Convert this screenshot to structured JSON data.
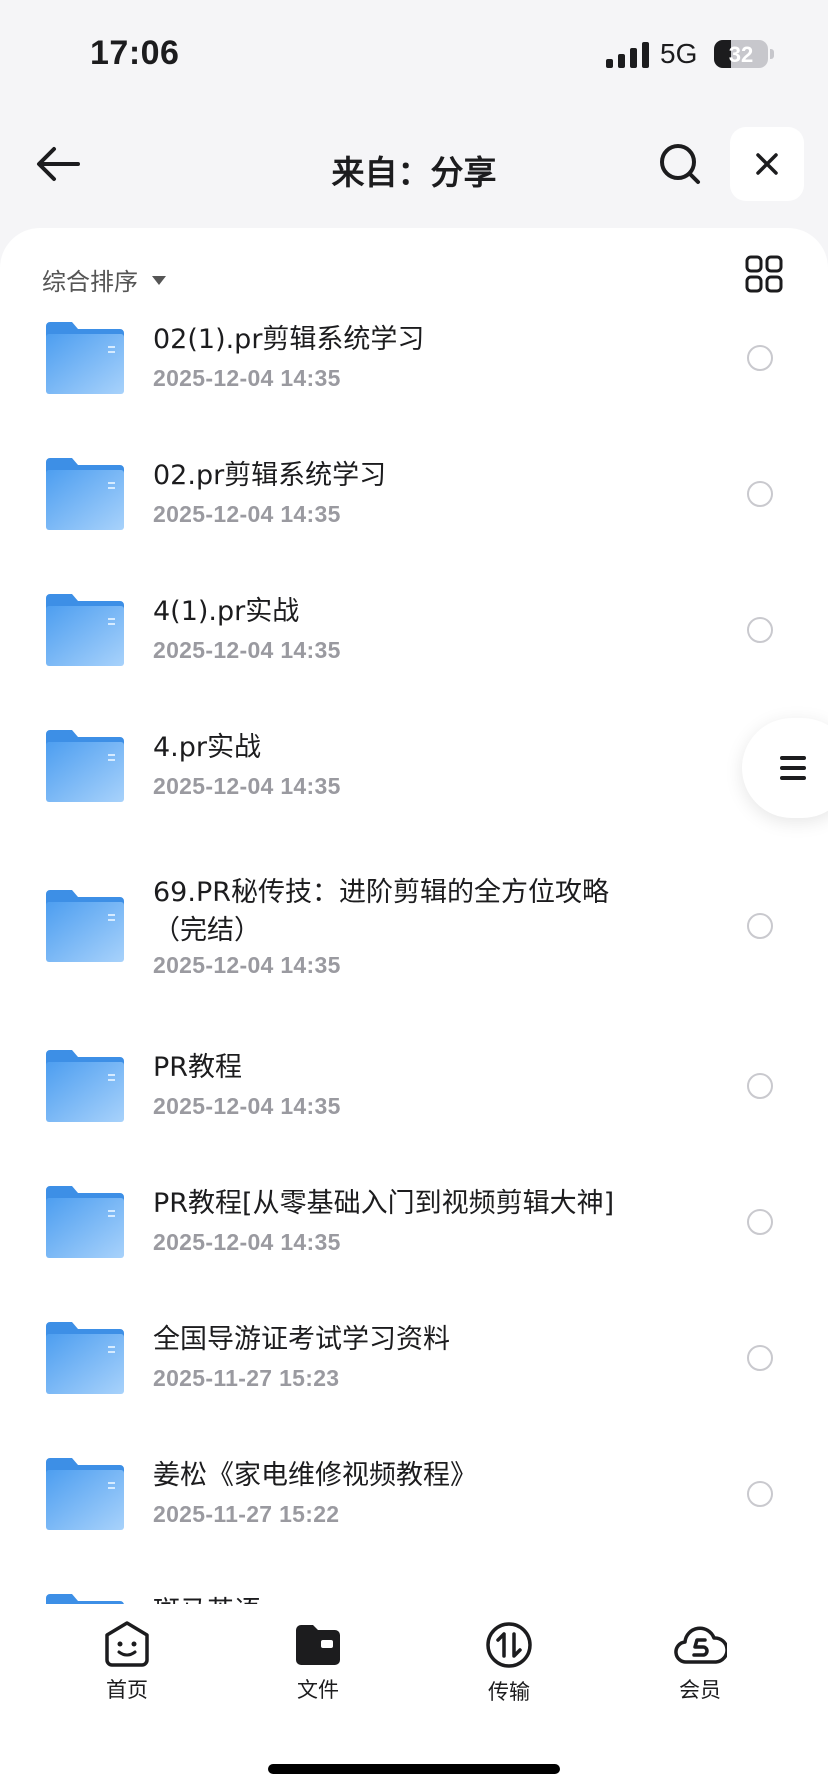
{
  "status_bar": {
    "time": "17:06",
    "network": "5G",
    "battery_percent": "32",
    "battery_level": 0.32
  },
  "header": {
    "title": "来自：分享",
    "back_icon": "arrow-left-icon",
    "search_icon": "search-icon",
    "close_icon": "close-icon"
  },
  "toolbar": {
    "sort_label": "综合排序",
    "view_toggle_icon": "grid-view-icon"
  },
  "files": [
    {
      "name": "02(1).pr剪辑系统学习",
      "date": "2025-12-04 14:35"
    },
    {
      "name": "02.pr剪辑系统学习",
      "date": "2025-12-04 14:35"
    },
    {
      "name": "4(1).pr实战",
      "date": "2025-12-04 14:35"
    },
    {
      "name": "4.pr实战",
      "date": "2025-12-04 14:35"
    },
    {
      "name": "69.PR秘传技：进阶剪辑的全方位攻略（完结）",
      "date": "2025-12-04 14:35"
    },
    {
      "name": "PR教程",
      "date": "2025-12-04 14:35"
    },
    {
      "name": "PR教程[从零基础入门到视频剪辑大神]",
      "date": "2025-12-04 14:35"
    },
    {
      "name": "全国导游证考试学习资料",
      "date": "2025-11-27 15:23"
    },
    {
      "name": "姜松《家电维修视频教程》",
      "date": "2025-11-27 15:22"
    },
    {
      "name": "斑马英语",
      "date": ""
    }
  ],
  "bottom_nav": {
    "items": [
      {
        "label": "首页",
        "icon": "smiley-home-icon"
      },
      {
        "label": "文件",
        "icon": "folder-icon"
      },
      {
        "label": "传输",
        "icon": "transfer-icon"
      },
      {
        "label": "会员",
        "icon": "cloud-member-icon"
      }
    ]
  },
  "colors": {
    "folder": "#5aa9f2",
    "background": "#f5f5f7",
    "text_primary": "#1c1c1e",
    "text_secondary": "#9a9aa0"
  }
}
